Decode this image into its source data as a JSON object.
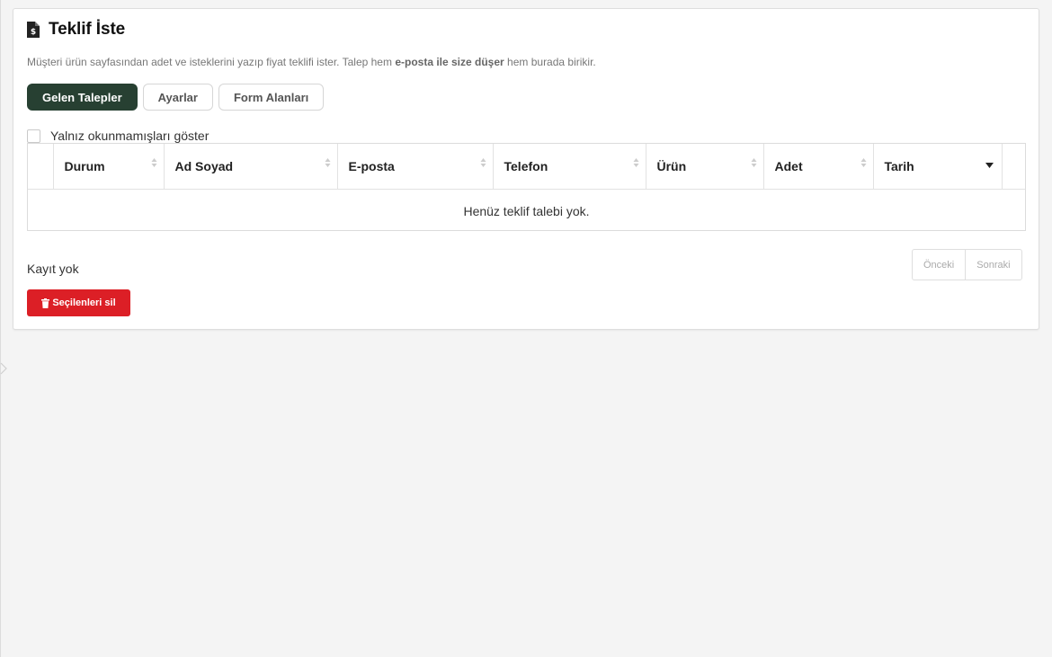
{
  "page": {
    "title": "Teklif İste",
    "title_icon": "invoice-dollar-icon",
    "description_parts": [
      "Müşteri ürün sayfasından adet ve isteklerini yazıp fiyat teklifi ister. Talep hem ",
      "e-posta ile size düşer",
      " hem burada birikir."
    ]
  },
  "tabs": [
    {
      "label": "Gelen Talepler",
      "active": true
    },
    {
      "label": "Ayarlar",
      "active": false
    },
    {
      "label": "Form Alanları",
      "active": false
    }
  ],
  "filter": {
    "label": "Yalnız okunmamışları göster",
    "checked": false
  },
  "table": {
    "columns": [
      "Durum",
      "Ad Soyad",
      "E-posta",
      "Telefon",
      "Ürün",
      "Adet",
      "Tarih"
    ],
    "sorted_column": "Tarih",
    "empty_message": "Henüz teklif talebi yok."
  },
  "footer": {
    "record_info": "Kayıt yok",
    "prev_label": "Önceki",
    "next_label": "Sonraki"
  },
  "actions": {
    "delete_selected_label": "Seçilenleri sil",
    "delete_icon": "trash-icon"
  },
  "colors": {
    "primary": "#274032",
    "danger": "#dc1f26",
    "background": "#f4f4f4"
  }
}
